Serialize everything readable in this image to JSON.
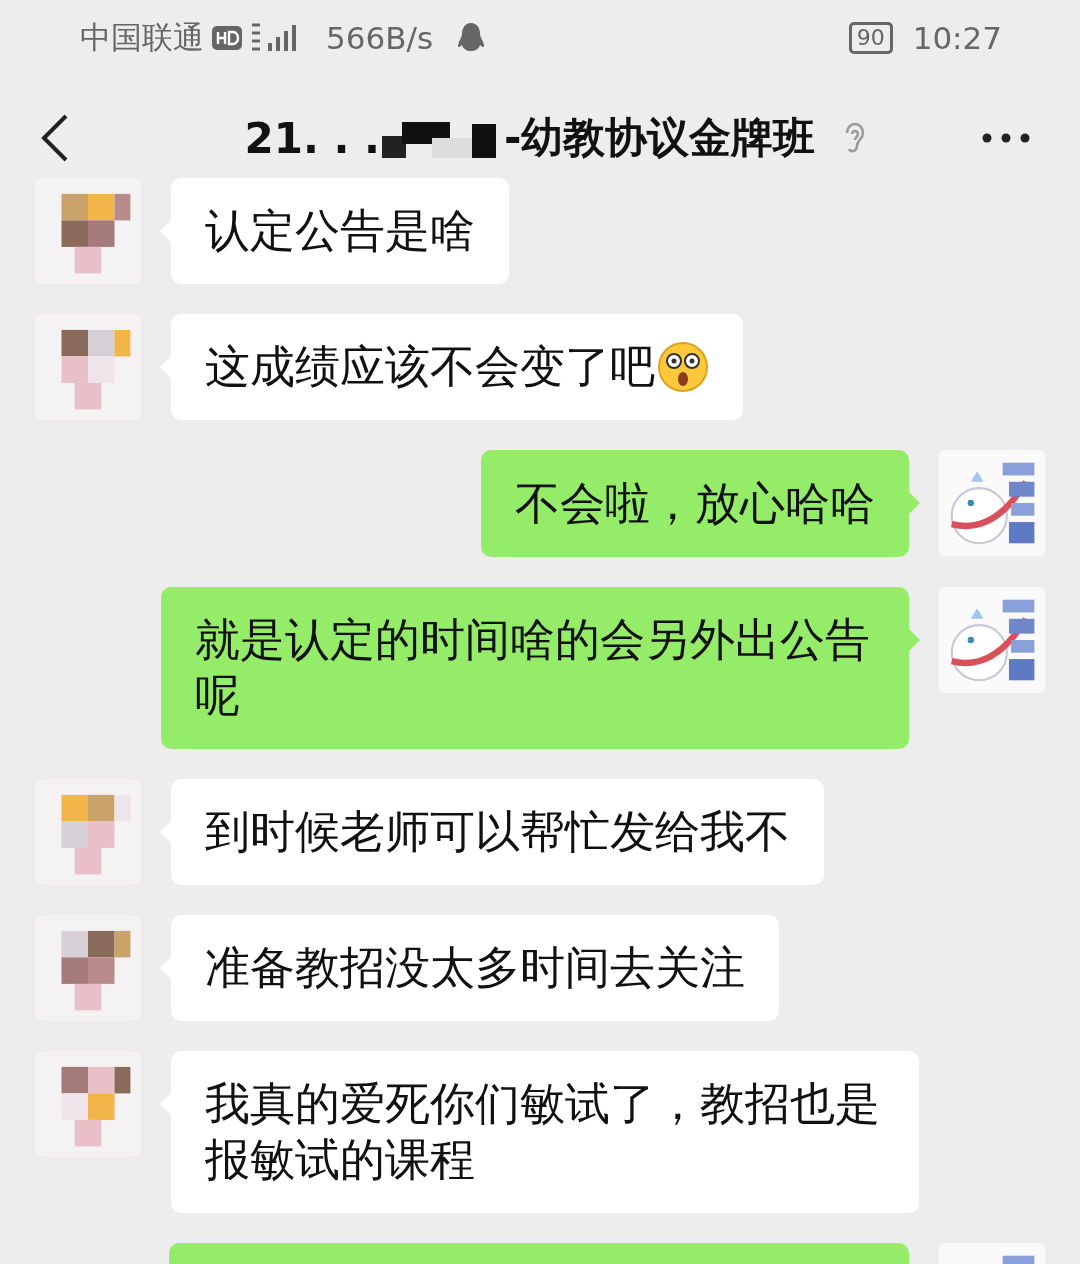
{
  "status_bar": {
    "carrier": "中国联通",
    "speed": "566B/s",
    "battery": "90",
    "time": "10:27"
  },
  "header": {
    "title_start": "21. . .",
    "title_end": "-幼教协议金牌班"
  },
  "messages": [
    {
      "kind": "received",
      "text": "认定公告是啥"
    },
    {
      "kind": "received",
      "text": "这成绩应该不会变了吧",
      "emoji": true
    },
    {
      "kind": "sent",
      "text": "不会啦，放心哈哈"
    },
    {
      "kind": "sent",
      "text": "就是认定的时间啥的会另外出公告呢"
    },
    {
      "kind": "received",
      "text": "到时候老师可以帮忙发给我不"
    },
    {
      "kind": "received",
      "text": "准备教招没太多时间去关注"
    },
    {
      "kind": "received",
      "text": "我真的爱死你们敏试了，教招也是报敏试的课程"
    },
    {
      "kind": "sent"
    }
  ]
}
